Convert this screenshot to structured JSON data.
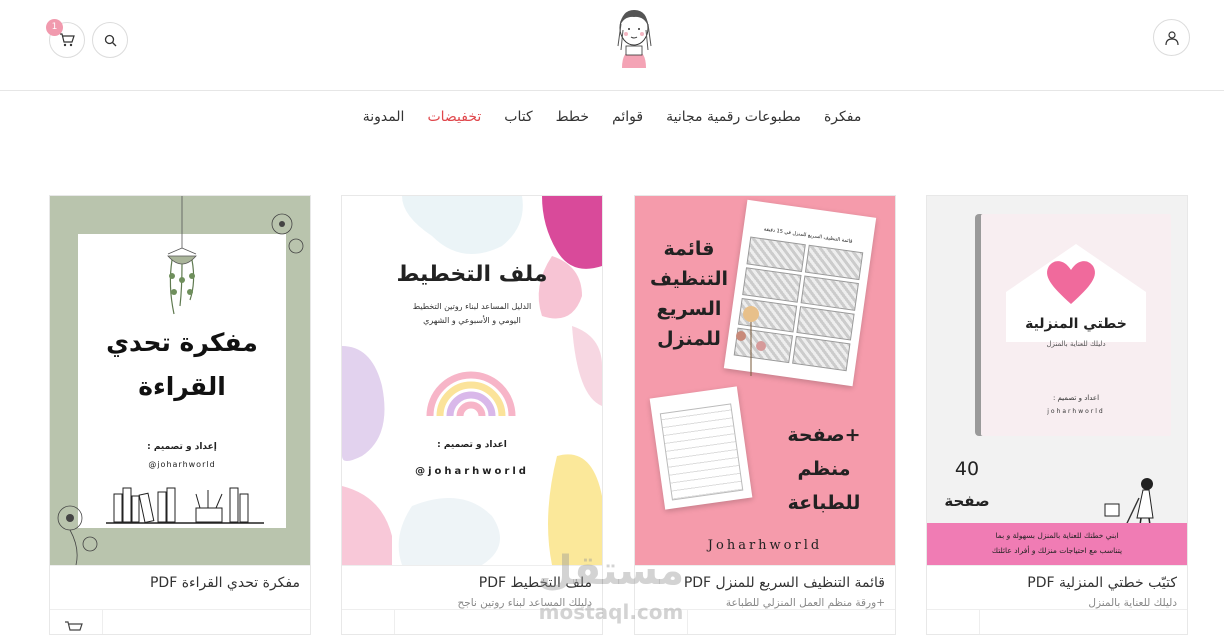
{
  "header": {
    "cart_count": "1",
    "icons": {
      "cart": "cart-icon",
      "search": "search-icon",
      "account": "user-icon",
      "logo": "logo-girl-illustration"
    }
  },
  "nav": {
    "items": [
      {
        "label": "مفكرة"
      },
      {
        "label": "مطبوعات رقمية مجانية"
      },
      {
        "label": "قوائم"
      },
      {
        "label": "خطط"
      },
      {
        "label": "كتاب"
      },
      {
        "label": "تخفيضات",
        "color": "#e0474c"
      },
      {
        "label": "المدونة"
      }
    ]
  },
  "products": [
    {
      "title": "كتيّب خطتي المنزلية PDF",
      "subtitle": "دليلك للعناية بالمنزل",
      "cover": {
        "book_title": "خطتي المنزلية",
        "book_subtitle": "دليلك للعناية بالمنزل",
        "credit": "اعداد و تصميم :",
        "brand": "joharhworld",
        "pages_number": "40",
        "pages_label": "صفحة",
        "banner_line1": "ابني خطتك للعناية بالمنزل بسهولة و بما",
        "banner_line2": "يتناسب مع احتياجات منزلك و أفراد عائلتك"
      }
    },
    {
      "title": "قائمة التنظيف السريع للمنزل PDF",
      "subtitle": "+ورقة منظم العمل المنزلي للطباعة",
      "cover": {
        "line1": "قائمة",
        "line2": "التنظيف",
        "line3": "السريع",
        "line4": "للمنزل",
        "bonus1": "+صفحة",
        "bonus2": "منظم",
        "bonus3": "للطباعة",
        "brand": "Joharhworld",
        "sheet_title": "قائمة التنظيف السريع للمنزل في 15 دقيقة"
      }
    },
    {
      "title": "ملف التخطيط PDF",
      "subtitle": "دليلك المساعد لبناء روتين ناجح",
      "cover": {
        "title": "ملف التخطيط",
        "desc1": "الدليل المساعد لبناء روتين التخطيط",
        "desc2": "اليومي و الأسبوعي و الشهري",
        "credit": "اعداد و تصميم :",
        "brand": "@joharhworld"
      }
    },
    {
      "title": "مفكرة تحدي القراءة PDF",
      "subtitle": "",
      "cover": {
        "line1": "مفكرة تحدي",
        "line2": "القراءة",
        "credit": "إعداد و تصميم :",
        "brand": "@joharhworld"
      }
    }
  ],
  "watermark": {
    "arabic": "مستقل",
    "latin": "mostaql.com"
  },
  "colors": {
    "accent_sale": "#e0474c",
    "badge": "#f19aae",
    "pink_cover": "#f59bab",
    "sage_cover": "#b9c4ad"
  }
}
